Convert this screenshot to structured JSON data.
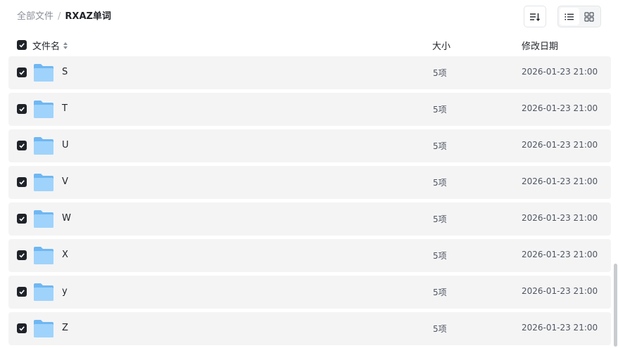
{
  "breadcrumb": {
    "root": "全部文件",
    "separator": "/",
    "current": "RXAZ单词"
  },
  "toolbar": {
    "sort_icon": "sort-list-icon",
    "view_list_icon": "list-view-icon",
    "view_grid_icon": "grid-view-icon",
    "active_view": "list"
  },
  "table": {
    "headers": {
      "name": "文件名",
      "size": "大小",
      "date": "修改日期"
    },
    "all_checked": true,
    "rows": [
      {
        "name": "S",
        "size": "5项",
        "date": "2026-01-23 21:00",
        "checked": true,
        "icon": "folder-icon"
      },
      {
        "name": "T",
        "size": "5项",
        "date": "2026-01-23 21:00",
        "checked": true,
        "icon": "folder-icon"
      },
      {
        "name": "U",
        "size": "5项",
        "date": "2026-01-23 21:00",
        "checked": true,
        "icon": "folder-icon"
      },
      {
        "name": "V",
        "size": "5项",
        "date": "2026-01-23 21:00",
        "checked": true,
        "icon": "folder-icon"
      },
      {
        "name": "W",
        "size": "5项",
        "date": "2026-01-23 21:00",
        "checked": true,
        "icon": "folder-icon"
      },
      {
        "name": "X",
        "size": "5项",
        "date": "2026-01-23 21:00",
        "checked": true,
        "icon": "folder-icon"
      },
      {
        "name": "y",
        "size": "5项",
        "date": "2026-01-23 21:00",
        "checked": true,
        "icon": "folder-icon"
      },
      {
        "name": "Z",
        "size": "5项",
        "date": "2026-01-23 21:00",
        "checked": true,
        "icon": "folder-icon"
      }
    ]
  },
  "colors": {
    "folder": "#7cc0f5",
    "row_background": "#f4f4f5",
    "checkbox": "#1f2329"
  }
}
